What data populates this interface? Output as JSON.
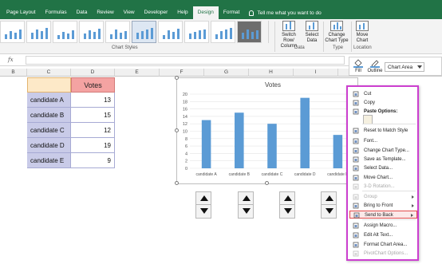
{
  "ribbon": {
    "tabs": [
      "Page Layout",
      "Formulas",
      "Data",
      "Review",
      "View",
      "Developer",
      "Help",
      "Design",
      "Format"
    ],
    "active_tab": "Design",
    "tell_me": "Tell me what you want to do",
    "chart_styles_label": "Chart Styles",
    "switch_row_column": "Switch Row/\nColumn",
    "select_data": "Select\nData",
    "data_group_label": "Data",
    "change_chart_type": "Change\nChart Type",
    "type_group_label": "Type",
    "move_chart": "Move\nChart",
    "location_group_label": "Location"
  },
  "formula_bar": {
    "fx": "fx",
    "value": ""
  },
  "columns": [
    "B",
    "C",
    "D",
    "E",
    "F",
    "G",
    "H",
    "I"
  ],
  "table": {
    "header": "Votes",
    "rows": [
      {
        "name": "candidate A",
        "votes": "13"
      },
      {
        "name": "candidate B",
        "votes": "15"
      },
      {
        "name": "candidate C",
        "votes": "12"
      },
      {
        "name": "candidate D",
        "votes": "19"
      },
      {
        "name": "candidate E",
        "votes": "9"
      }
    ]
  },
  "chart_data": {
    "type": "bar",
    "title": "Votes",
    "categories": [
      "candidate A",
      "candidate B",
      "candidate C",
      "candidate D",
      "candidate E"
    ],
    "values": [
      13,
      15,
      12,
      19,
      9
    ],
    "ylim": [
      0,
      20
    ],
    "yticks": [
      "0",
      "2",
      "4",
      "6",
      "8",
      "10",
      "12",
      "14",
      "16",
      "18",
      "20"
    ],
    "color": "#5b9bd5",
    "grid": true
  },
  "mini_toolbar": {
    "fill": "Fill",
    "outline": "Outline",
    "chart_area": "Chart Area"
  },
  "context_menu": {
    "items": [
      {
        "label": "Cut",
        "icon": "scissors-icon",
        "disabled": false
      },
      {
        "label": "Copy",
        "icon": "copy-icon",
        "disabled": false
      },
      {
        "label": "Paste Options:",
        "icon": "paste-icon",
        "disabled": false,
        "header": true
      },
      {
        "label": "Reset to Match Style",
        "icon": "reset-icon",
        "disabled": false
      },
      {
        "label": "Font...",
        "icon": "font-icon",
        "disabled": false
      },
      {
        "label": "Change Chart Type...",
        "icon": "chart-type-icon",
        "disabled": false
      },
      {
        "label": "Save as Template...",
        "icon": "template-icon",
        "disabled": false
      },
      {
        "label": "Select Data...",
        "icon": "select-data-icon",
        "disabled": false
      },
      {
        "label": "Move Chart...",
        "icon": "move-chart-icon",
        "disabled": false
      },
      {
        "label": "3-D Rotation...",
        "icon": "rotation-icon",
        "disabled": true
      },
      {
        "label": "Group",
        "icon": "group-icon",
        "disabled": true,
        "submenu": true
      },
      {
        "label": "Bring to Front",
        "icon": "bring-front-icon",
        "disabled": false,
        "submenu": true
      },
      {
        "label": "Send to Back",
        "icon": "send-back-icon",
        "disabled": false,
        "submenu": true,
        "highlight": true
      },
      {
        "label": "Assign Macro...",
        "icon": "macro-icon",
        "disabled": false
      },
      {
        "label": "Edit Alt Text...",
        "icon": "alt-text-icon",
        "disabled": false
      },
      {
        "label": "Format Chart Area...",
        "icon": "format-icon",
        "disabled": false
      },
      {
        "label": "PivotChart Options...",
        "icon": "pivot-icon",
        "disabled": true
      }
    ]
  }
}
